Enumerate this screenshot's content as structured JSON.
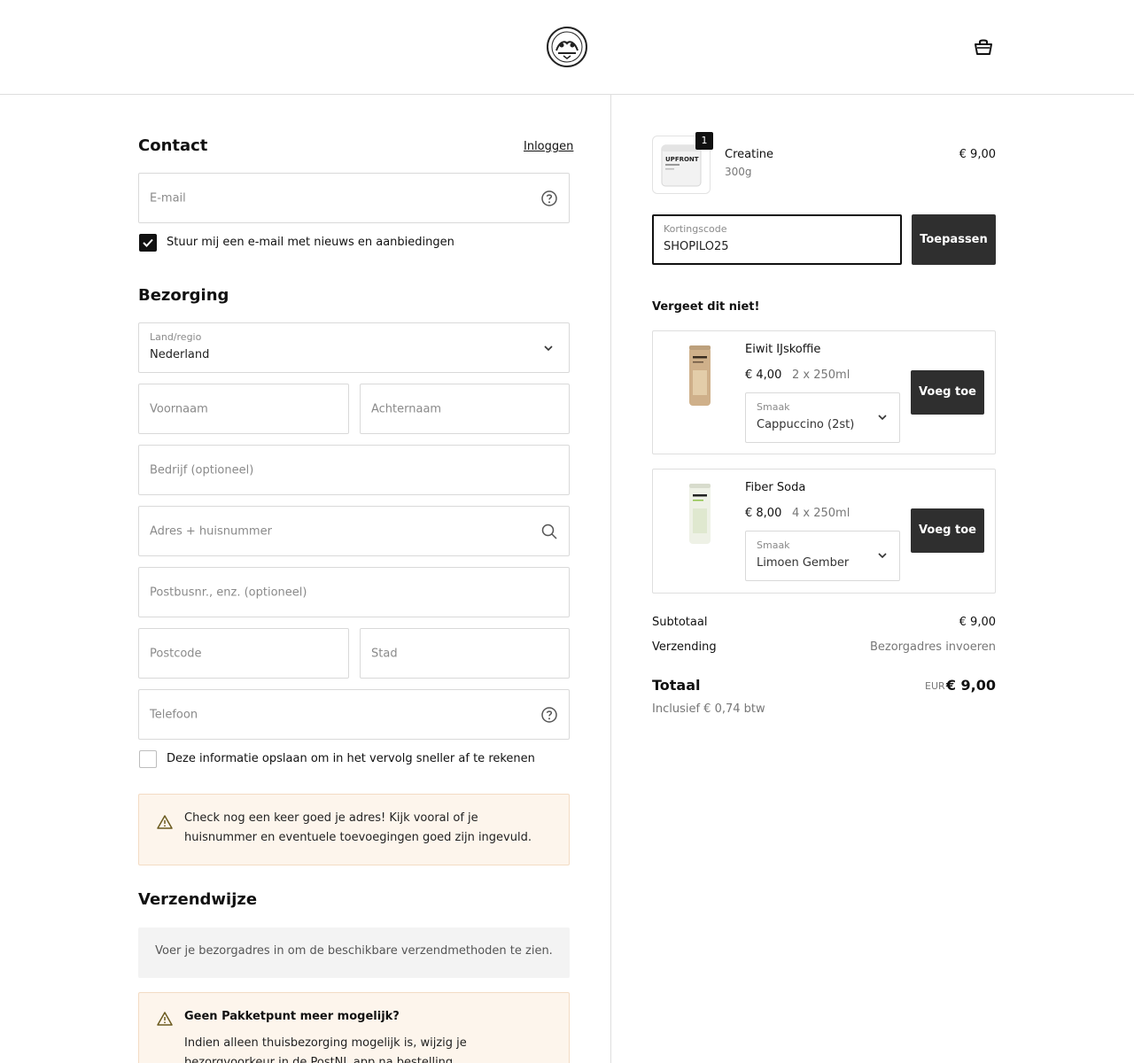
{
  "contact": {
    "heading": "Contact",
    "login_link": "Inloggen",
    "email_placeholder": "E-mail",
    "newsletter_label": "Stuur mij een e-mail met nieuws en aanbiedingen",
    "newsletter_checked": true
  },
  "delivery": {
    "heading": "Bezorging",
    "country_label": "Land/regio",
    "country_value": "Nederland",
    "first_name_placeholder": "Voornaam",
    "last_name_placeholder": "Achternaam",
    "company_placeholder": "Bedrijf (optioneel)",
    "address_placeholder": "Adres + huisnummer",
    "address2_placeholder": "Postbusnr., enz. (optioneel)",
    "postcode_placeholder": "Postcode",
    "city_placeholder": "Stad",
    "phone_placeholder": "Telefoon",
    "save_info_label": "Deze informatie opslaan om in het vervolg sneller af te rekenen",
    "save_info_checked": false,
    "address_notice": "Check nog een keer goed je adres! Kijk vooral of je huisnummer en eventuele toevoegingen goed zijn ingevuld."
  },
  "shipping": {
    "heading": "Verzendwijze",
    "empty_text": "Voer je bezorgadres in om de beschikbare verzendmethoden te zien.",
    "pakketpunt_title": "Geen Pakketpunt meer mogelijk?",
    "pakketpunt_text": "Indien alleen thuisbezorging mogelijk is, wijzig je bezorgvoorkeur in de PostNL app na bestelling."
  },
  "order": {
    "item": {
      "name": "Creatine",
      "variant": "300g",
      "price": "€ 9,00",
      "quantity": "1",
      "brand_text": "UPFRONT"
    },
    "discount_label": "Kortingscode",
    "discount_value": "SHOPILO25",
    "apply_button": "Toepassen",
    "upsell_heading": "Vergeet dit niet!",
    "upsells": [
      {
        "name": "Eiwit IJskoffie",
        "price": "€ 4,00",
        "pack": "2 x 250ml",
        "flavor_label": "Smaak",
        "flavor_value": "Cappuccino (2st)",
        "button": "Voeg toe"
      },
      {
        "name": "Fiber Soda",
        "price": "€ 8,00",
        "pack": "4 x 250ml",
        "flavor_label": "Smaak",
        "flavor_value": "Limoen Gember",
        "button": "Voeg toe"
      }
    ],
    "subtotal_label": "Subtotaal",
    "subtotal_value": "€ 9,00",
    "shipping_label": "Verzending",
    "shipping_value": "Bezorgadres invoeren",
    "total_label": "Totaal",
    "currency": "EUR",
    "total_value": "€ 9,00",
    "vat_text": "Inclusief € 0,74 btw"
  }
}
